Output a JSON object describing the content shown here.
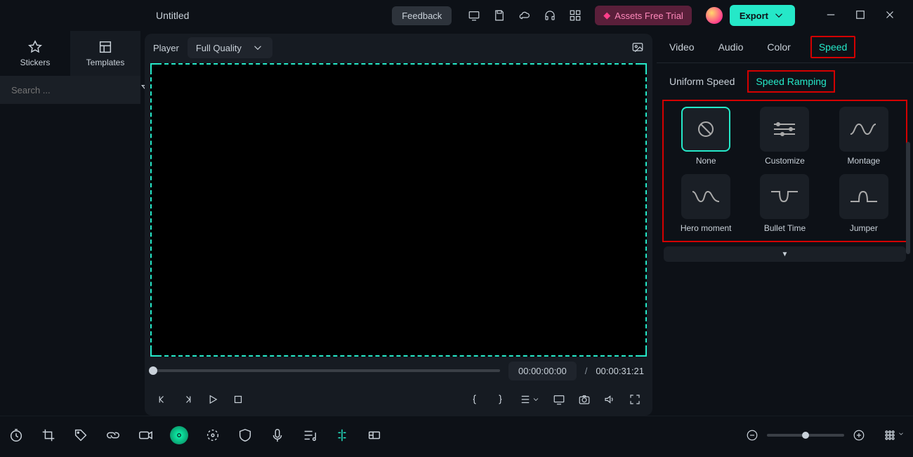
{
  "header": {
    "title": "Untitled",
    "feedback": "Feedback",
    "assets_trial": "Assets Free Trial",
    "export": "Export"
  },
  "left": {
    "tabs": {
      "stickers": "Stickers",
      "templates": "Templates"
    },
    "search_placeholder": "Search ..."
  },
  "player": {
    "label": "Player",
    "quality": "Full Quality",
    "time": "00:00:00:00",
    "sep": "/",
    "duration": "00:00:31:21"
  },
  "right": {
    "tabs": {
      "video": "Video",
      "audio": "Audio",
      "color": "Color",
      "speed": "Speed"
    },
    "subtabs": {
      "uniform": "Uniform Speed",
      "ramping": "Speed Ramping"
    },
    "presets": {
      "none": "None",
      "customize": "Customize",
      "montage": "Montage",
      "hero": "Hero moment",
      "bullet": "Bullet Time",
      "jumper": "Jumper"
    }
  }
}
